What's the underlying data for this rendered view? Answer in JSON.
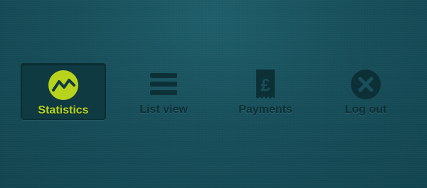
{
  "colors": {
    "background": "#174f5a",
    "active_tab_background": "#0f3a42",
    "accent": "#b8d31c",
    "inactive_icon": "#0d3037"
  },
  "nav": {
    "items": [
      {
        "label": "Statistics",
        "icon": "statistics-chart-icon",
        "active": true
      },
      {
        "label": "List view",
        "icon": "list-lines-icon",
        "active": false
      },
      {
        "label": "Payments",
        "icon": "pound-receipt-icon",
        "active": false
      },
      {
        "label": "Log out",
        "icon": "close-circle-icon",
        "active": false
      }
    ]
  }
}
